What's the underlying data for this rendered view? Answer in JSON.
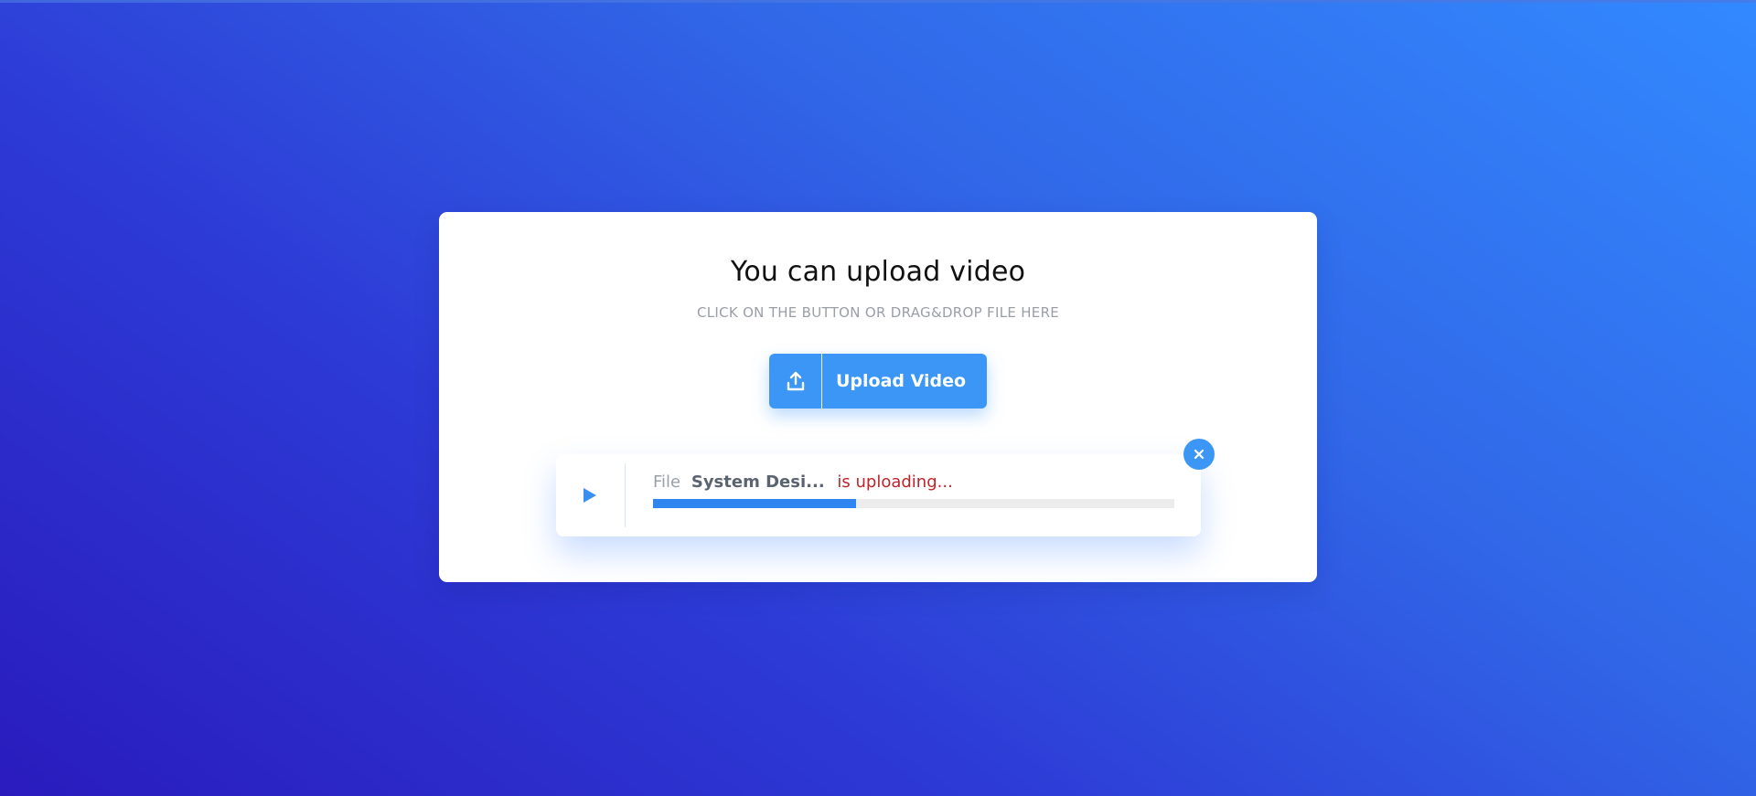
{
  "upload_panel": {
    "title": "You can upload video",
    "subtitle": "CLICK ON THE BUTTON OR DRAG&DROP FILE HERE",
    "upload_button_label": "Upload Video",
    "upload_icon": "upload-icon"
  },
  "file_item": {
    "file_label": "File",
    "file_name": "System Desi...",
    "status": "is uploading...",
    "progress": 0.39,
    "play_icon": "play-icon",
    "close_icon": "close-icon"
  },
  "colors": {
    "accent": "#3b96f5",
    "progress_fill": "#2f86f0",
    "status_text": "#c0242a",
    "gradient_start": "#2a1bbd",
    "gradient_end": "#3289ff"
  }
}
